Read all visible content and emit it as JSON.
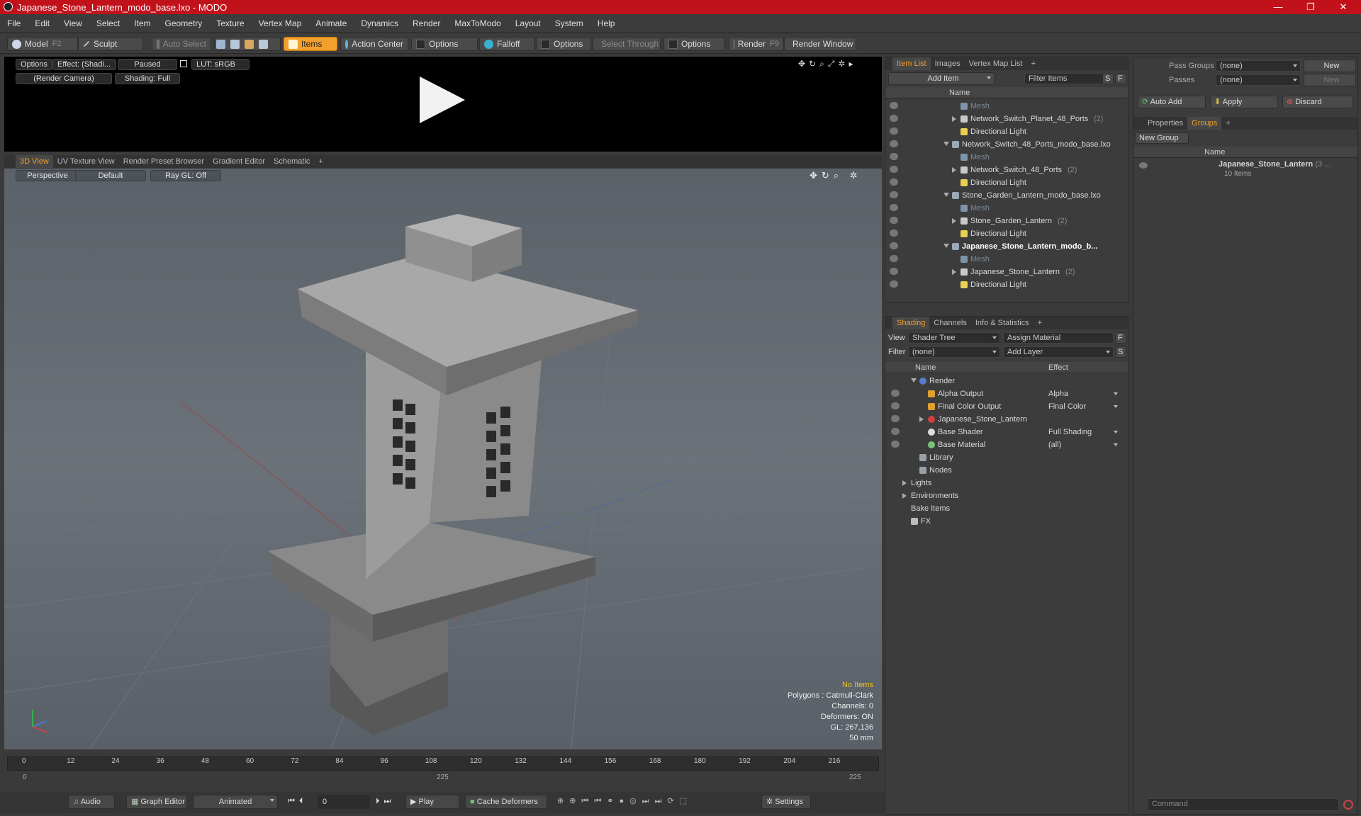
{
  "window": {
    "title": "Japanese_Stone_Lantern_modo_base.lxo - MODO"
  },
  "menu": [
    "File",
    "Edit",
    "View",
    "Select",
    "Item",
    "Geometry",
    "Texture",
    "Vertex Map",
    "Animate",
    "Dynamics",
    "Render",
    "MaxToModo",
    "Layout",
    "System",
    "Help"
  ],
  "toolbar": {
    "model": "Model",
    "model_key": "F2",
    "sculpt": "Sculpt",
    "auto_select": "Auto Select",
    "items": "Items",
    "action_center": "Action Center",
    "options1": "Options",
    "falloff": "Falloff",
    "options2": "Options",
    "select_through": "Select Through",
    "options3": "Options",
    "render": "Render",
    "render_key": "F9",
    "render_window": "Render Window"
  },
  "render_preview": {
    "options": "Options",
    "effect": "Effect: (Shadi...",
    "paused": "Paused",
    "lut": "LUT: sRGB",
    "camera": "(Render Camera)",
    "shading": "Shading: Full"
  },
  "viewport_tabs": [
    "3D View",
    "UV Texture View",
    "Render Preset Browser",
    "Gradient Editor",
    "Schematic",
    "+"
  ],
  "viewport": {
    "perspective": "Perspective",
    "default": "Default",
    "raygl": "Ray GL: Off",
    "info": {
      "no_items": "No Items",
      "polygons": "Polygons : Catmull-Clark",
      "channels": "Channels: 0",
      "deformers": "Deformers: ON",
      "gl": "GL: 267,136",
      "size": "50 mm"
    }
  },
  "timeline": {
    "ticks": [
      "0",
      "12",
      "24",
      "36",
      "48",
      "60",
      "72",
      "84",
      "96",
      "108",
      "120",
      "132",
      "144",
      "156",
      "168",
      "180",
      "192",
      "204",
      "216"
    ],
    "start": "0",
    "mid": "225",
    "end": "225"
  },
  "transport": {
    "audio": "Audio",
    "graph_editor": "Graph Editor",
    "animated": "Animated",
    "frame": "0",
    "play": "Play",
    "cache": "Cache Deformers",
    "settings": "Settings"
  },
  "item_list": {
    "tabs": [
      "Item List",
      "Images",
      "Vertex Map List",
      "+"
    ],
    "add_item": "Add Item",
    "filter": "Filter Items",
    "s": "S",
    "f": "F",
    "col_name": "Name",
    "rows": [
      {
        "indent": 3,
        "label": "Mesh",
        "count": "",
        "style": "dim",
        "arrow": "",
        "icon": "mesh"
      },
      {
        "indent": 3,
        "label": "Network_Switch_Planet_48_Ports",
        "count": "(2)",
        "style": "",
        "arrow": "r",
        "icon": "loc"
      },
      {
        "indent": 3,
        "label": "Directional Light",
        "count": "",
        "style": "",
        "arrow": "",
        "icon": "light"
      },
      {
        "indent": 2,
        "label": "Network_Switch_48_Ports_modo_base.lxo",
        "count": "",
        "style": "",
        "arrow": "d",
        "icon": "scene"
      },
      {
        "indent": 3,
        "label": "Mesh",
        "count": "",
        "style": "dim",
        "arrow": "",
        "icon": "mesh"
      },
      {
        "indent": 3,
        "label": "Network_Switch_48_Ports",
        "count": "(2)",
        "style": "",
        "arrow": "r",
        "icon": "loc"
      },
      {
        "indent": 3,
        "label": "Directional Light",
        "count": "",
        "style": "",
        "arrow": "",
        "icon": "light"
      },
      {
        "indent": 2,
        "label": "Stone_Garden_Lantern_modo_base.lxo",
        "count": "",
        "style": "",
        "arrow": "d",
        "icon": "scene"
      },
      {
        "indent": 3,
        "label": "Mesh",
        "count": "",
        "style": "dim",
        "arrow": "",
        "icon": "mesh"
      },
      {
        "indent": 3,
        "label": "Stone_Garden_Lantern",
        "count": "(2)",
        "style": "",
        "arrow": "r",
        "icon": "loc"
      },
      {
        "indent": 3,
        "label": "Directional Light",
        "count": "",
        "style": "",
        "arrow": "",
        "icon": "light"
      },
      {
        "indent": 2,
        "label": "Japanese_Stone_Lantern_modo_b...",
        "count": "",
        "style": "sel",
        "arrow": "d",
        "icon": "scene"
      },
      {
        "indent": 3,
        "label": "Mesh",
        "count": "",
        "style": "dim",
        "arrow": "",
        "icon": "mesh"
      },
      {
        "indent": 3,
        "label": "Japanese_Stone_Lantern",
        "count": "(2)",
        "style": "",
        "arrow": "r",
        "icon": "loc"
      },
      {
        "indent": 3,
        "label": "Directional Light",
        "count": "",
        "style": "",
        "arrow": "",
        "icon": "light"
      }
    ]
  },
  "shading": {
    "tabs": [
      "Shading",
      "Channels",
      "Info & Statistics",
      "+"
    ],
    "view_label": "View",
    "view_value": "Shader Tree",
    "assign_material": "Assign Material",
    "filter_label": "Filter",
    "filter_value": "(none)",
    "add_layer": "Add Layer",
    "f": "F",
    "s": "S",
    "col_name": "Name",
    "col_effect": "Effect",
    "rows": [
      {
        "indent": 1,
        "label": "Render",
        "effect": "",
        "arrow": "d",
        "icon": "render",
        "eye": false
      },
      {
        "indent": 2,
        "label": "Alpha Output",
        "effect": "Alpha",
        "arrow": "",
        "icon": "output",
        "eye": true
      },
      {
        "indent": 2,
        "label": "Final Color Output",
        "effect": "Final Color",
        "arrow": "",
        "icon": "output",
        "eye": true
      },
      {
        "indent": 2,
        "label": "Japanese_Stone_Lantern",
        "effect": "",
        "arrow": "r",
        "icon": "mat",
        "eye": true
      },
      {
        "indent": 2,
        "label": "Base Shader",
        "effect": "Full Shading",
        "arrow": "",
        "icon": "shader",
        "eye": true
      },
      {
        "indent": 2,
        "label": "Base Material",
        "effect": "(all)",
        "arrow": "",
        "icon": "basemat",
        "eye": true
      },
      {
        "indent": 1,
        "label": "Library",
        "effect": "",
        "arrow": "",
        "icon": "folder",
        "eye": false
      },
      {
        "indent": 1,
        "label": "Nodes",
        "effect": "",
        "arrow": "",
        "icon": "folder",
        "eye": false
      },
      {
        "indent": 0,
        "label": "Lights",
        "effect": "",
        "arrow": "r",
        "icon": "",
        "eye": false
      },
      {
        "indent": 0,
        "label": "Environments",
        "effect": "",
        "arrow": "r",
        "icon": "",
        "eye": false
      },
      {
        "indent": 0,
        "label": "Bake Items",
        "effect": "",
        "arrow": "",
        "icon": "",
        "eye": false
      },
      {
        "indent": 0,
        "label": "FX",
        "effect": "",
        "arrow": "",
        "icon": "fx",
        "eye": false
      }
    ]
  },
  "groups_panel": {
    "pass_groups_label": "Pass Groups",
    "pass_groups_value": "(none)",
    "new": "New",
    "passes_label": "Passes",
    "passes_value": "(none)",
    "new2": "New",
    "auto_add": "Auto Add",
    "apply": "Apply",
    "discard": "Discard",
    "tabs": [
      "Properties",
      "Groups",
      "+"
    ],
    "new_group": "New Group",
    "col_name": "Name",
    "group_name": "Japanese_Stone_Lantern",
    "group_count": "(3 ...",
    "group_items": "10 Items"
  },
  "command": {
    "placeholder": "Command"
  },
  "colors": {
    "accent": "#f29f2c",
    "title_bar": "#c1121c"
  }
}
